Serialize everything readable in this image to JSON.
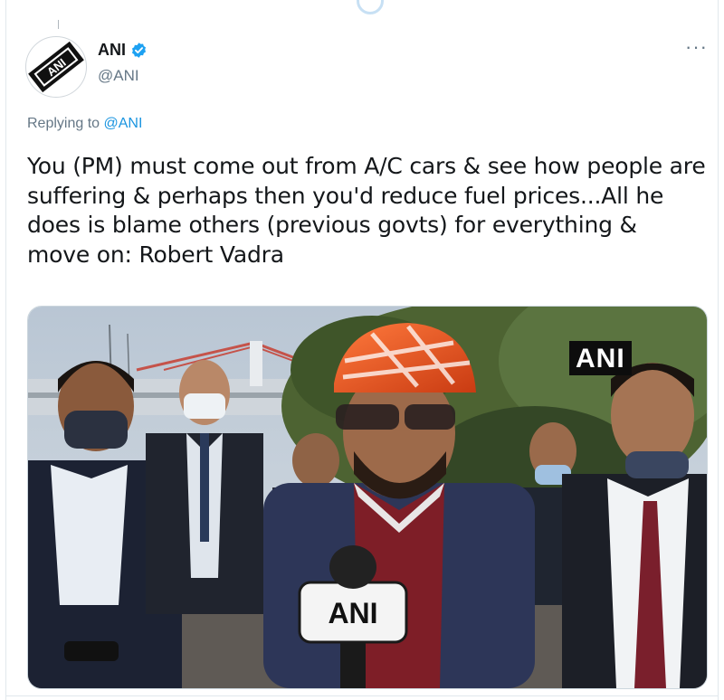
{
  "tweet": {
    "author": {
      "name": "ANI",
      "handle": "@ANI",
      "verified": true,
      "avatar_text": "ANI"
    },
    "menu_icon": "more-horizontal-icon",
    "replying_to_prefix": "Replying to",
    "replying_to_handle": "@ANI",
    "text": "You (PM) must come out from A/C cars & see how people are suffering & perhaps then you'd reduce fuel prices...All he does is blame others (previous govts) for everything & move on: Robert Vadra",
    "media": {
      "watermark": "ANI",
      "mic_label": "ANI"
    }
  },
  "colors": {
    "accent": "#1b95e0",
    "secondary_text": "#657786",
    "primary_text": "#14171a",
    "verified": "#1da1f2"
  }
}
